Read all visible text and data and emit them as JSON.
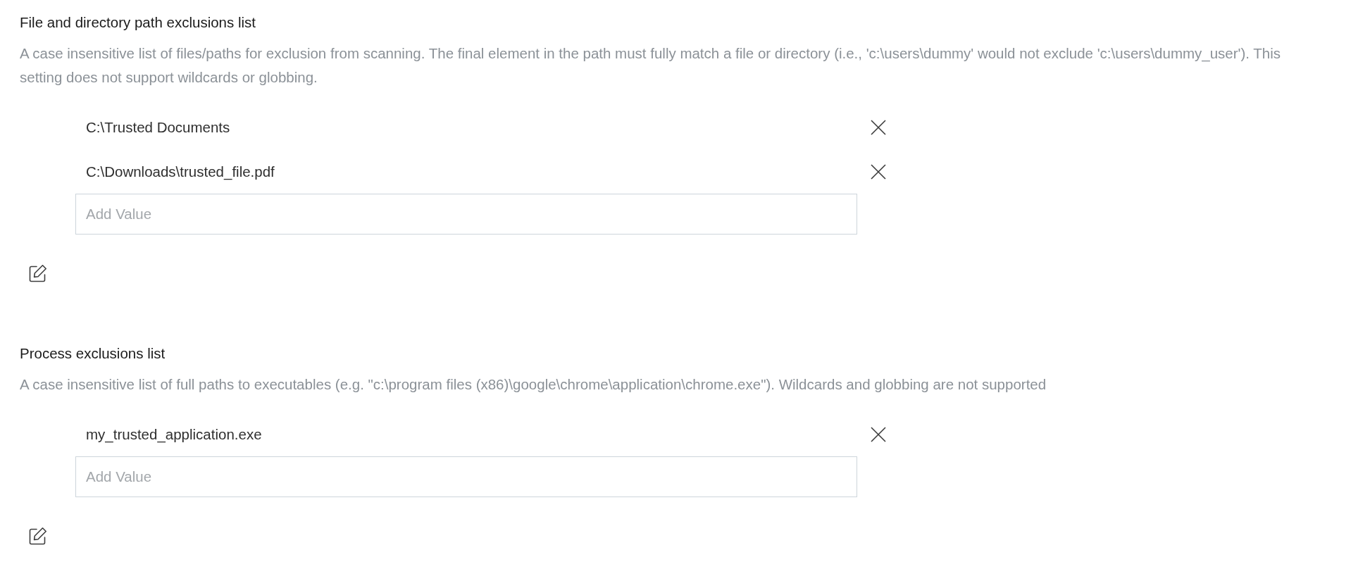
{
  "sections": [
    {
      "title": "File and directory path exclusions list",
      "description": "A case insensitive list of files/paths for exclusion from scanning. The final element in the path must fully match a file or directory (i.e., 'c:\\users\\dummy' would not exclude 'c:\\users\\dummy_user'). This setting does not support wildcards or globbing.",
      "entries": [
        "C:\\Trusted Documents",
        "C:\\Downloads\\trusted_file.pdf"
      ],
      "new_value": {
        "placeholder": "Add Value"
      }
    },
    {
      "title": "Process exclusions list",
      "description": "A case insensitive list of full paths to executables (e.g. \"c:\\program files (x86)\\google\\chrome\\application\\chrome.exe\"). Wildcards and globbing are not supported",
      "entries": [
        "my_trusted_application.exe"
      ],
      "new_value": {
        "placeholder": "Add Value"
      }
    }
  ]
}
